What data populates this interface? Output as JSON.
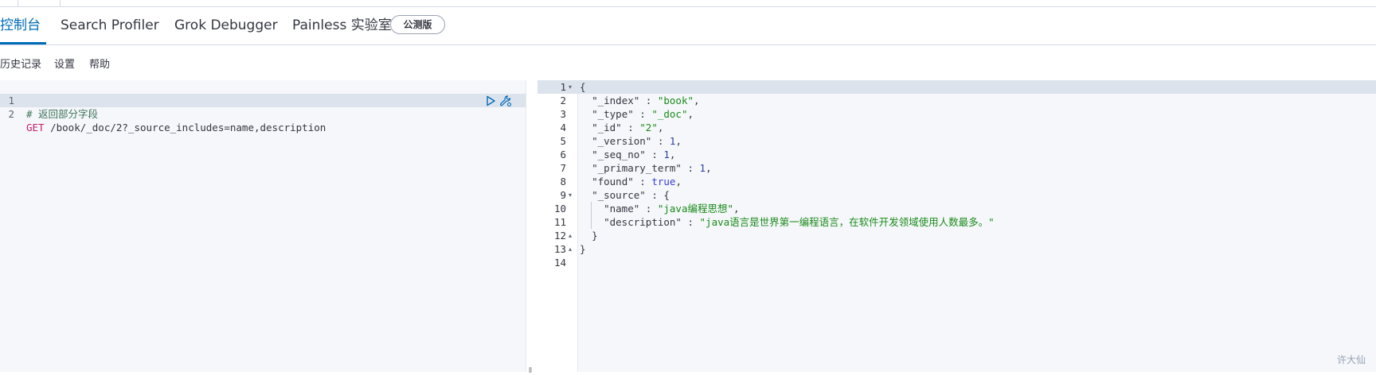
{
  "tabs": [
    {
      "label": "控制台",
      "active": true
    },
    {
      "label": "Search Profiler",
      "active": false
    },
    {
      "label": "Grok Debugger",
      "active": false
    },
    {
      "label": "Painless 实验室",
      "active": false
    }
  ],
  "beta_badge": "公测版",
  "toolbar": {
    "history": "历史记录",
    "settings": "设置",
    "help": "帮助"
  },
  "editor": {
    "lines": [
      {
        "n": "1",
        "comment": "# 返回部分字段"
      },
      {
        "n": "2",
        "method": "GET",
        "path": " /book/_doc/2?_source_includes=name,description"
      }
    ],
    "icons": [
      "play-icon",
      "wrench-icon"
    ]
  },
  "output": {
    "line_numbers": [
      "1",
      "2",
      "3",
      "4",
      "5",
      "6",
      "7",
      "8",
      "9",
      "10",
      "11",
      "12",
      "13",
      "14"
    ],
    "json": {
      "open": "{",
      "index_key": "\"_index\"",
      "index_val": "\"book\"",
      "type_key": "\"_type\"",
      "type_val": "\"_doc\"",
      "id_key": "\"_id\"",
      "id_val": "\"2\"",
      "version_key": "\"_version\"",
      "version_val": "1",
      "seq_key": "\"_seq_no\"",
      "seq_val": "1",
      "term_key": "\"_primary_term\"",
      "term_val": "1",
      "found_key": "\"found\"",
      "found_val": "true",
      "source_key": "\"_source\"",
      "source_open": "{",
      "name_key": "\"name\"",
      "name_val": "\"java编程思想\"",
      "desc_key": "\"description\"",
      "desc_val": "\"java语言是世界第一编程语言，在软件开发领域使用人数最多。\"",
      "source_close": "}",
      "close": "}"
    }
  },
  "watermark": "许大仙"
}
